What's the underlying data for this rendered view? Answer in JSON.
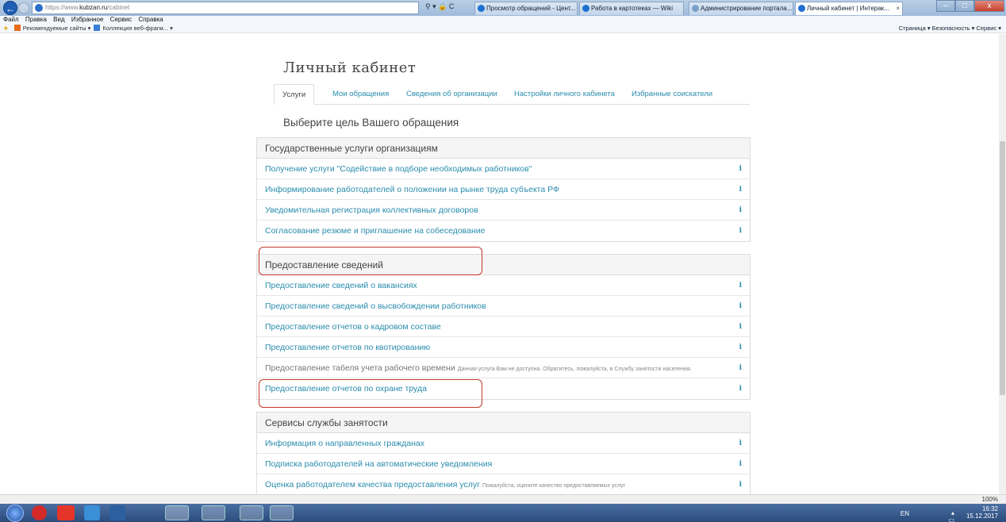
{
  "browser": {
    "url_prefix": "https://www.",
    "url_domain": "kubzan.ru",
    "url_path": "/cabinet",
    "address_tools": "⚲ ▾ 🔒 C",
    "tabs": [
      {
        "label": "Просмотр обращений - Цент..."
      },
      {
        "label": "Работа в картотеках — Wiki"
      },
      {
        "label": "Администрирование портала..."
      },
      {
        "label": "Личный кабинет | Интерак...",
        "close": "×"
      }
    ],
    "menu": [
      "Файл",
      "Правка",
      "Вид",
      "Избранное",
      "Сервис",
      "Справка"
    ],
    "favorites": {
      "recommended": "Рекомендуемые сайты ▾",
      "collection": "Коллекция веб-фрагм... ▾"
    },
    "command_bar": "Страница ▾  Безопасность ▾  Сервис ▾",
    "window_buttons": {
      "minimize": "–",
      "maximize": "□",
      "close": "x"
    },
    "zoom": "100%"
  },
  "page": {
    "title": "Личный кабинет",
    "tabs": [
      {
        "label": "Услуги"
      },
      {
        "label": "Мои обращения"
      },
      {
        "label": "Сведения об организации"
      },
      {
        "label": "Настройки личного кабинета"
      },
      {
        "label": "Избранные соискатели"
      }
    ],
    "choose_label": "Выберите цель Вашего обращения",
    "info_glyph": "i",
    "sections": [
      {
        "title": "Государственные услуги организациям",
        "rows": [
          {
            "label": "Получение услуги \"Содействие в подборе необходимых работников\""
          },
          {
            "label": "Информирование работодателей о положении на рынке труда субъекта РФ"
          },
          {
            "label": "Уведомительная регистрация коллективных договоров"
          },
          {
            "label": "Согласование резюме и приглашение на собеседование"
          }
        ]
      },
      {
        "title": "Предоставление сведений",
        "rows": [
          {
            "label": "Предоставление сведений о вакансиях"
          },
          {
            "label": "Предоставление сведений о высвобождении работников"
          },
          {
            "label": "Предоставление отчетов о кадровом составе"
          },
          {
            "label": "Предоставление отчетов по квотированию"
          },
          {
            "label": "Предоставление табеля учета рабочего времени",
            "note": "Данная услуга Вам не доступна. Обратитесь, пожалуйста, в Службу занятости населения."
          },
          {
            "label": "Предоставление отчетов по охране труда"
          }
        ]
      },
      {
        "title": "Сервисы службы занятости",
        "rows": [
          {
            "label": "Информация о направленных гражданах"
          },
          {
            "label": "Подписка работодателей на автоматические уведомления"
          },
          {
            "label": "Оценка работодателем качества предоставления услуг",
            "note": "Пожалуйста, оцените качество предоставляемых услуг"
          }
        ]
      }
    ]
  },
  "taskbar": {
    "lang": "EN",
    "time": "16:32",
    "date": "15.12.2017"
  }
}
